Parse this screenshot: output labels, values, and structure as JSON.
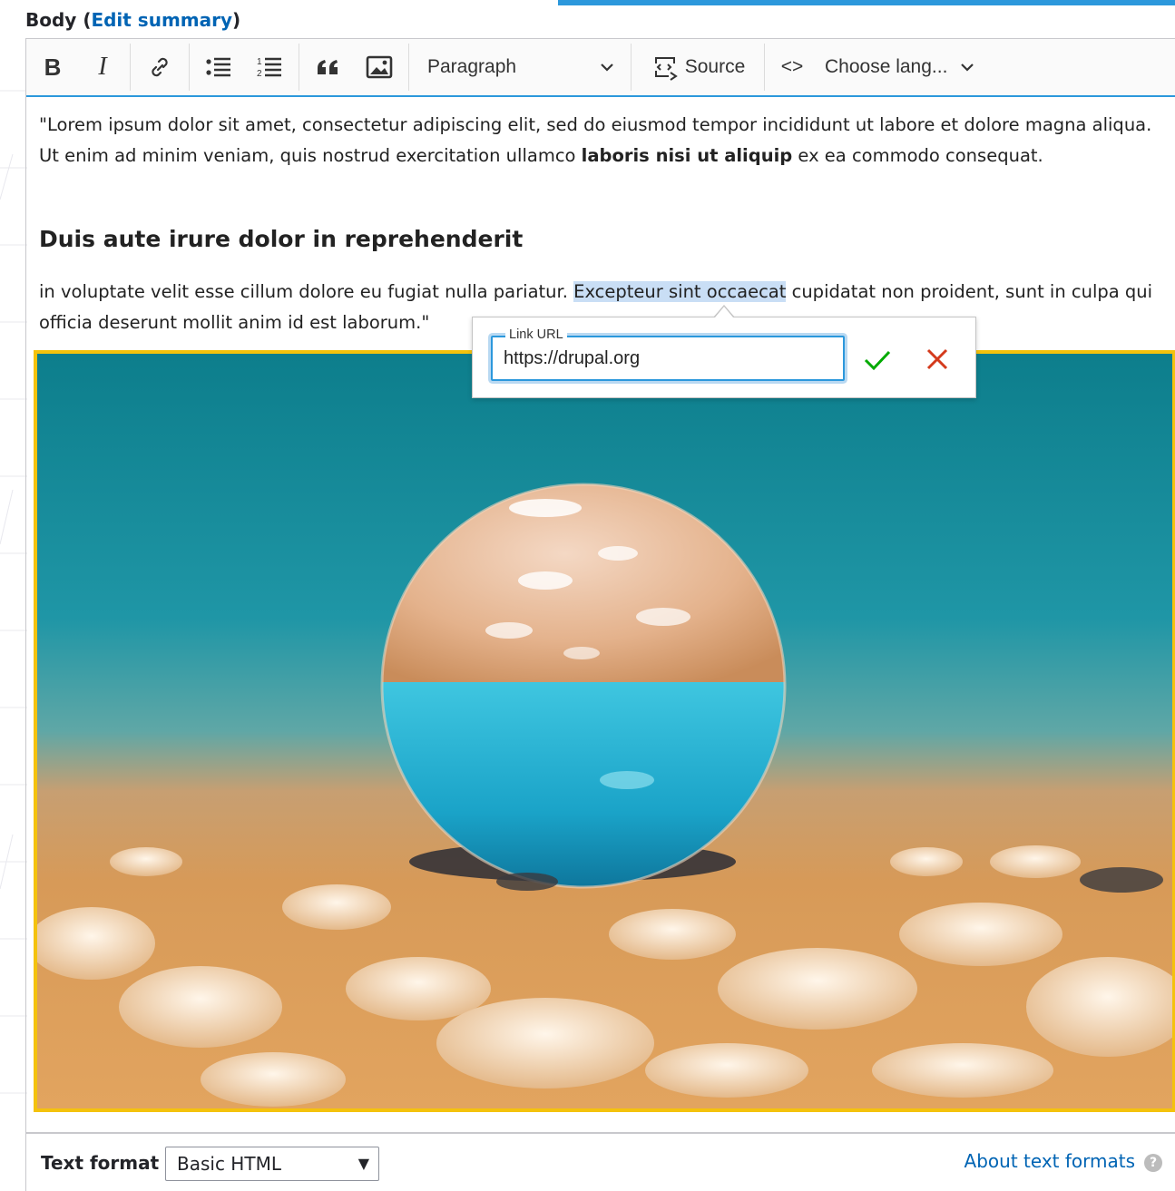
{
  "field": {
    "label": "Body",
    "open_paren": "(",
    "edit_summary": "Edit summary",
    "close_paren": ")"
  },
  "toolbar": {
    "bold": "B",
    "italic": "I",
    "heading_select": "Paragraph",
    "source": "Source",
    "code": "<>",
    "language_select": "Choose lang..."
  },
  "content": {
    "p1_a": "\"Lorem ipsum dolor sit amet, consectetur adipiscing elit, sed do eiusmod tempor incididunt ut labore et dolore magna aliqua. Ut enim ad minim veniam, quis nostrud exercitation ullamco ",
    "p1_bold": "laboris nisi ut aliquip",
    "p1_b": " ex ea commodo consequat.",
    "heading": "Duis aute irure dolor in reprehenderit",
    "p2_a": "in voluptate velit esse cillum dolore eu fugiat nulla pariatur. ",
    "p2_selected": "Excepteur sint occaecat",
    "p2_b": " cupidatat non proident, sunt in culpa qui officia deserunt mollit anim id est laborum.\""
  },
  "link_balloon": {
    "legend": "Link URL",
    "value": "https://drupal.org"
  },
  "footer": {
    "text_format_label": "Text format",
    "text_format_value": "Basic HTML",
    "about_link": "About text formats",
    "help": "?"
  },
  "colors": {
    "accent": "#2c98dc",
    "link": "#0064b4",
    "image_border": "#f4c20d",
    "ok": "#00aa00",
    "cancel": "#d43a1c"
  }
}
